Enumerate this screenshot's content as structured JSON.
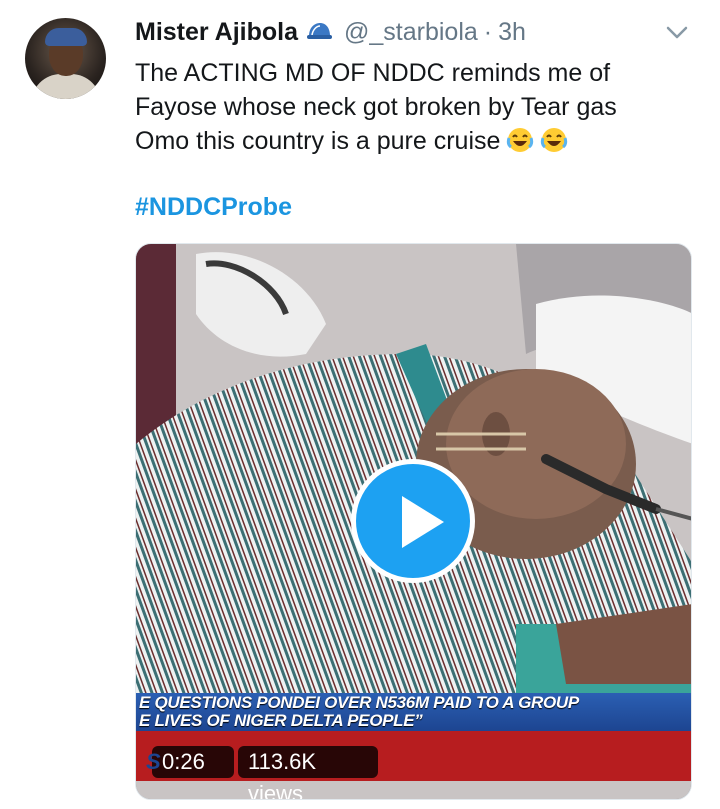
{
  "tweet": {
    "author_name": "Mister Ajibola",
    "verified_icon": "blue-cap-icon",
    "handle": "@_starbiola",
    "separator": "·",
    "time": "3h",
    "text_lines": [
      "The ACTING MD OF NDDC reminds me of",
      "Fayose whose neck got broken by Tear gas",
      "Omo this country is a pure cruise"
    ],
    "emoji": [
      "face-with-tears-of-joy",
      "face-with-tears-of-joy"
    ],
    "hashtag": "#NDDCProbe"
  },
  "video": {
    "banner_lines": [
      "E QUESTIONS PONDEI OVER N536M PAID TO A GROUP",
      "E LIVES OF NIGER DELTA PEOPLE”"
    ],
    "channel_fragment": "S",
    "duration": "0:26",
    "views": "113.6K views",
    "play_icon": "play-icon"
  },
  "colors": {
    "accent": "#1da1f2",
    "hashtag": "#1b95e0",
    "secondary_text": "#657786"
  }
}
